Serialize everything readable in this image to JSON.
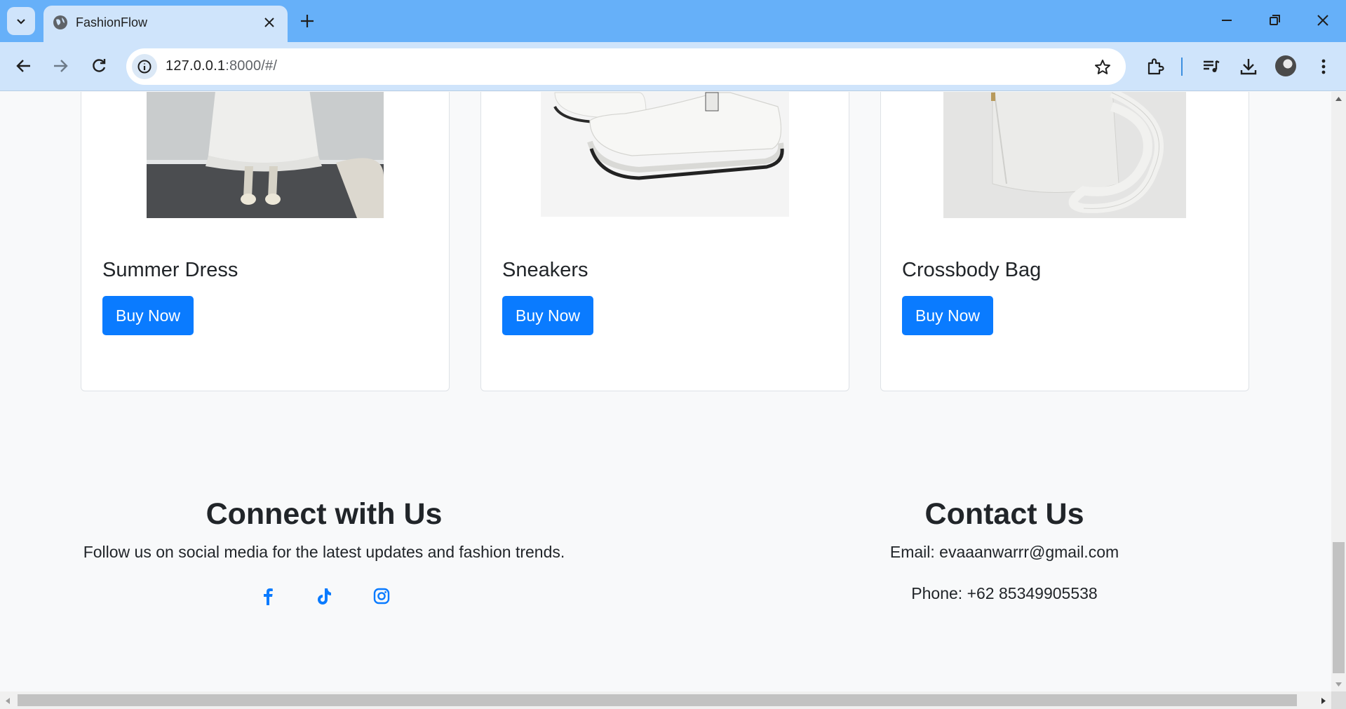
{
  "browser": {
    "tab_title": "FashionFlow",
    "url_host": "127.0.0.1",
    "url_rest": ":8000/#/"
  },
  "products": [
    {
      "name": "Summer Dress",
      "button": "Buy Now"
    },
    {
      "name": "Sneakers",
      "button": "Buy Now"
    },
    {
      "name": "Crossbody Bag",
      "button": "Buy Now"
    }
  ],
  "footer": {
    "connect": {
      "heading": "Connect with Us",
      "text": "Follow us on social media for the latest updates and fashion trends.",
      "icons": [
        "facebook-icon",
        "tiktok-icon",
        "instagram-icon"
      ]
    },
    "contact": {
      "heading": "Contact Us",
      "email": "Email: evaaanwarrr@gmail.com",
      "phone": "Phone: +62 85349905538"
    }
  },
  "colors": {
    "accent": "#0a7bff",
    "tabstrip": "#66b0f9",
    "toolbar": "#cfe4fb",
    "page_bg": "#f8f9fa"
  }
}
